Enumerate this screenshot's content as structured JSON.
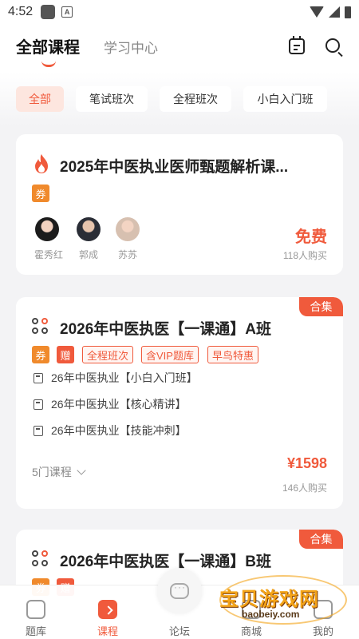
{
  "status_bar": {
    "time": "4:52",
    "a_badge": "A"
  },
  "header": {
    "tab_main": "全部课程",
    "tab_sub": "学习中心"
  },
  "filters": [
    "全部",
    "笔试班次",
    "全程班次",
    "小白入门班"
  ],
  "card1": {
    "title": "2025年中医执业医师甄题解析课...",
    "coupon_tag": "券",
    "teachers": [
      "霍秀红",
      "郭成",
      "苏苏"
    ],
    "price": "免费",
    "buyers": "118人购买"
  },
  "card2": {
    "badge": "合集",
    "title": "2026年中医执医【一课通】A班",
    "tags": {
      "coupon": "券",
      "gift": "赠",
      "t1": "全程班次",
      "t2": "含VIP题库",
      "t3": "早鸟特惠"
    },
    "sub_courses": [
      "26年中医执业【小白入门班】",
      "26年中医执业【核心精讲】",
      "26年中医执业【技能冲刺】"
    ],
    "course_count": "5门课程",
    "price": "¥1598",
    "buyers": "146人购买"
  },
  "card3": {
    "badge": "合集",
    "title": "2026年中医执医【一课通】B班",
    "tags": {
      "coupon": "券",
      "gift": "赠"
    }
  },
  "bottom_nav": [
    {
      "label": "题库",
      "icon": "question-bank-icon"
    },
    {
      "label": "课程",
      "icon": "course-icon"
    },
    {
      "label": "论坛",
      "icon": "chat-icon"
    },
    {
      "label": "商城",
      "icon": "shop-icon"
    },
    {
      "label": "我的",
      "icon": "profile-icon"
    }
  ],
  "watermark": {
    "text": "宝贝游戏网",
    "url": "baobeiy.com"
  },
  "colors": {
    "accent": "#f05a3c",
    "coupon": "#f08a2c",
    "background": "#f3f3f5"
  }
}
